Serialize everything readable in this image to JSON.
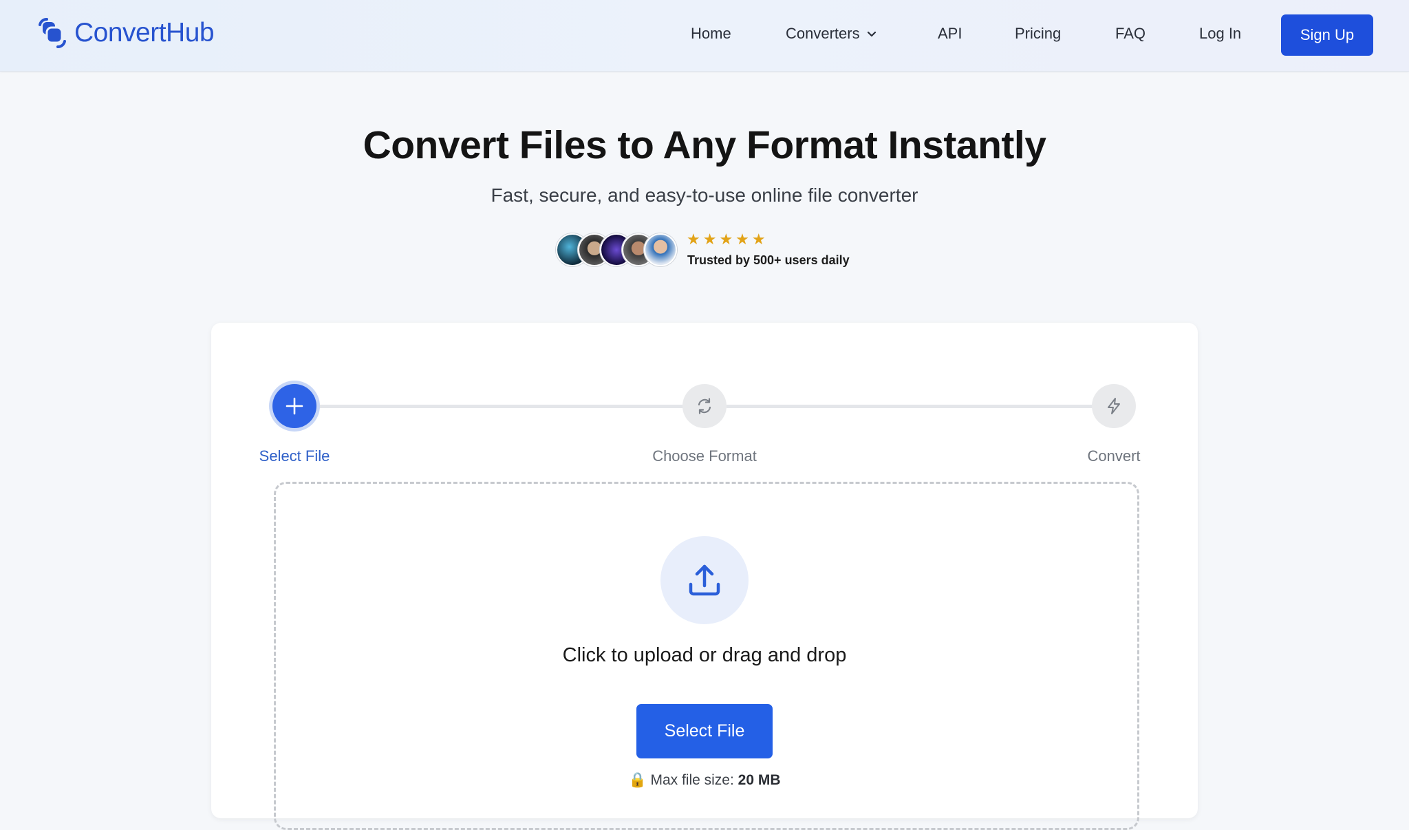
{
  "brand": {
    "name": "ConvertHub",
    "color": "#2753cf"
  },
  "nav": {
    "home": "Home",
    "converters": "Converters",
    "api": "API",
    "pricing": "Pricing",
    "faq": "FAQ",
    "login": "Log In",
    "signup": "Sign Up"
  },
  "hero": {
    "title": "Convert Files to Any Format Instantly",
    "subtitle": "Fast, secure, and easy-to-use online file converter",
    "stars": "★★★★★",
    "rating": 5,
    "trusted": "Trusted by 500+ users daily"
  },
  "steps": [
    {
      "label": "Select File",
      "icon": "plus-icon",
      "active": true
    },
    {
      "label": "Choose Format",
      "icon": "refresh-icon",
      "active": false
    },
    {
      "label": "Convert",
      "icon": "lightning-icon",
      "active": false
    }
  ],
  "upload": {
    "icon": "upload-icon",
    "prompt": "Click to upload or drag and drop",
    "button": "Select File",
    "lock_icon": "🔒",
    "max_label": "Max file size:",
    "max_value": "20 MB"
  },
  "colors": {
    "accent": "#1e4fdc",
    "step_active": "#2e63e6",
    "star": "#e2a318"
  }
}
